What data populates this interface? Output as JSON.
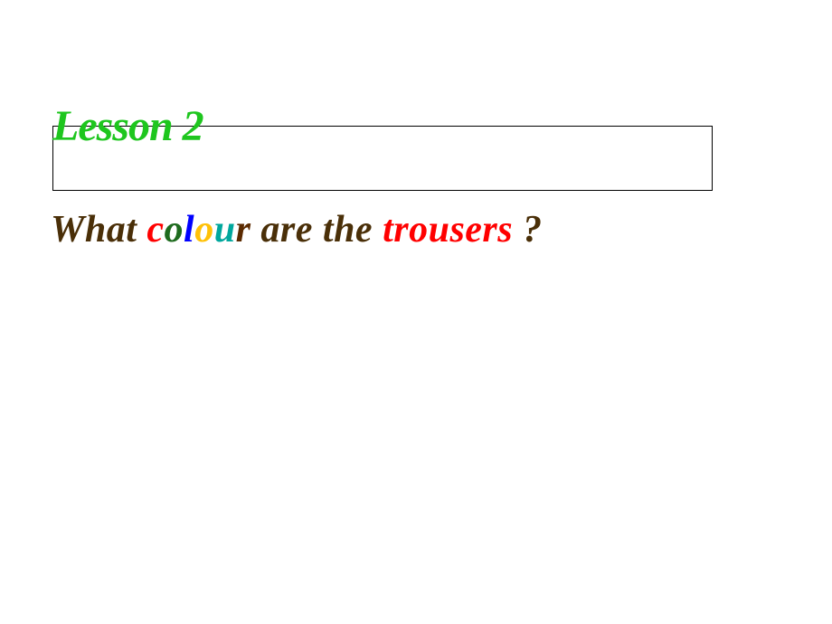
{
  "slide": {
    "lesson_title": "Lesson 2",
    "question": {
      "what": "What ",
      "colour_letters": {
        "c": "c",
        "o1": "o",
        "l": "l",
        "o2": "o",
        "u": "u",
        "r": "r"
      },
      "are_the": " are the ",
      "trousers": "trousers",
      "qmark": " ?"
    }
  }
}
